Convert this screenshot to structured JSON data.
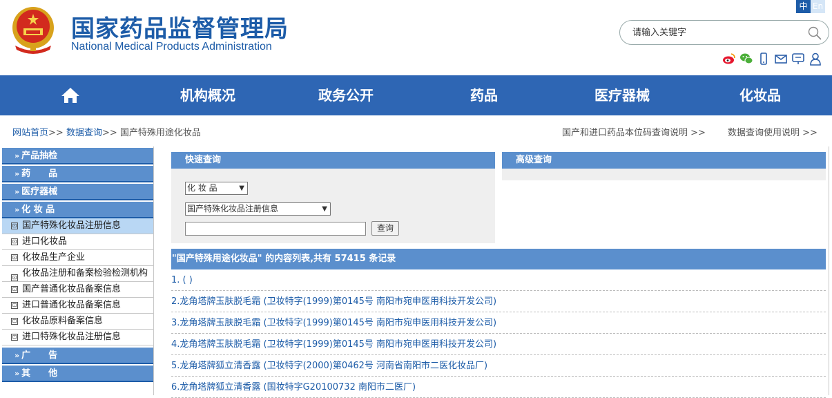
{
  "header": {
    "title_cn": "国家药品监督管理局",
    "title_en": "National Medical Products Administration",
    "lang_zh": "中",
    "lang_en": "En",
    "search_placeholder": "请输入关键字"
  },
  "nav": {
    "items": [
      "机构概况",
      "政务公开",
      "药品",
      "医疗器械",
      "化妆品"
    ]
  },
  "breadcrumb": {
    "home": "网站首页",
    "data_query": "数据查询",
    "current": "国产特殊用途化妆品",
    "sep": ">>",
    "link_code": "国产和进口药品本位码查询说明 >>",
    "link_usage": "数据查询使用说明 >>"
  },
  "sidebar": {
    "cats": [
      "产品抽检",
      "药　　品",
      "医疗器械",
      "化 妆 品",
      "广　　告",
      "其　　他"
    ],
    "subs": [
      "国产特殊化妆品注册信息",
      "进口化妆品",
      "化妆品生产企业",
      "化妆品注册和备案检验检测机构",
      "国产普通化妆品备案信息",
      "进口普通化妆品备案信息",
      "化妆品原料备案信息",
      "进口特殊化妆品注册信息"
    ]
  },
  "quick_query": {
    "title": "快速查询",
    "select1": "化 妆 品",
    "select2": "国产特殊化妆品注册信息",
    "button": "查询"
  },
  "advanced_query": {
    "title": "高级查询"
  },
  "results": {
    "header": "\"国产特殊用途化妆品\" 的内容列表,共有 57415 条记录",
    "rows": [
      "1. ( )",
      "2.龙角塔牌玉肤脱毛霜 (卫妆特字(1999)第0145号 南阳市宛申医用科技开发公司)",
      "3.龙角塔牌玉肤脱毛霜 (卫妆特字(1999)第0145号 南阳市宛申医用科技开发公司)",
      "4.龙角塔牌玉肤脱毛霜 (卫妆特字(1999)第0145号 南阳市宛申医用科技开发公司)",
      "5.龙角塔牌狐立清香露 (卫妆特字(2000)第0462号 河南省南阳市二医化妆品厂)",
      "6.龙角塔牌狐立清香露 (国妆特字G20100732 南阳市二医厂)"
    ]
  }
}
